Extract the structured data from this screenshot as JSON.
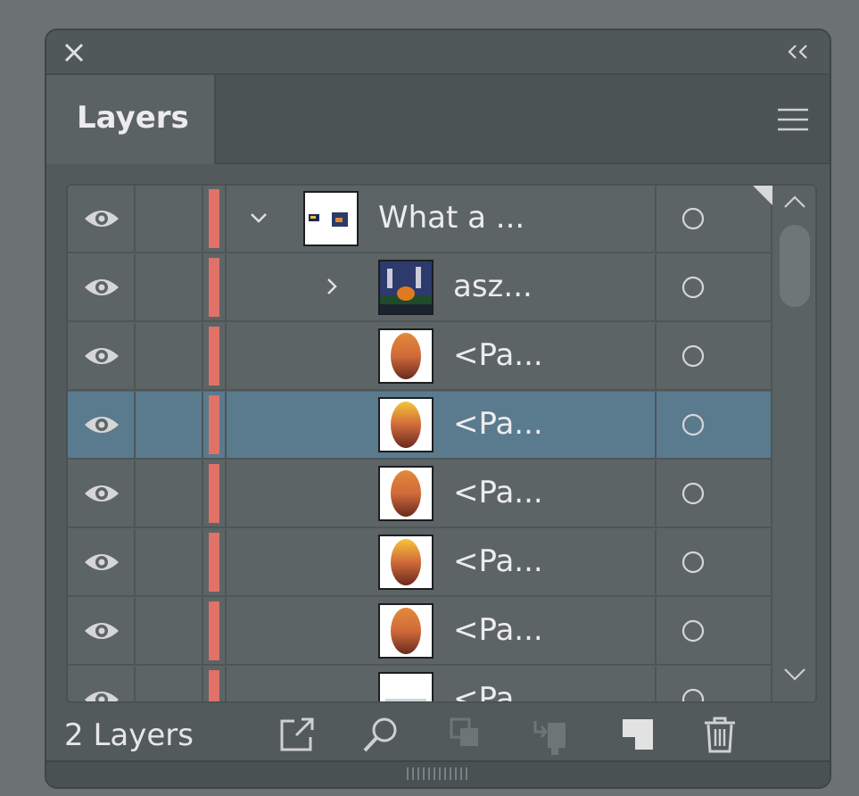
{
  "panel": {
    "tab_label": "Layers",
    "layer_count": "2 Layers"
  },
  "layers": [
    {
      "name": "What a ...",
      "indent": 0,
      "chevron": "down",
      "thumb": "doc",
      "selected": false
    },
    {
      "name": "asz...",
      "indent": 1,
      "chevron": "right",
      "thumb": "scene",
      "selected": false
    },
    {
      "name": "<Pa...",
      "indent": 2,
      "chevron": "",
      "thumb": "egg-dark",
      "selected": false
    },
    {
      "name": "<Pa...",
      "indent": 2,
      "chevron": "",
      "thumb": "egg-yellow",
      "selected": true
    },
    {
      "name": "<Pa...",
      "indent": 2,
      "chevron": "",
      "thumb": "egg-dark",
      "selected": false
    },
    {
      "name": "<Pa...",
      "indent": 2,
      "chevron": "",
      "thumb": "egg-yellow",
      "selected": false
    },
    {
      "name": "<Pa...",
      "indent": 2,
      "chevron": "",
      "thumb": "egg-dark",
      "selected": false
    },
    {
      "name": "<Pa",
      "indent": 2,
      "chevron": "",
      "thumb": "egg-plain",
      "selected": false
    }
  ],
  "colors": {
    "layer_color": "#e07268",
    "selection": "#5a7a8e",
    "panel_bg": "#525a5c"
  },
  "footer_icons": [
    "export-icon",
    "search-icon",
    "clipping-mask-icon",
    "move-to-layer-icon",
    "new-layer-icon",
    "delete-icon"
  ]
}
